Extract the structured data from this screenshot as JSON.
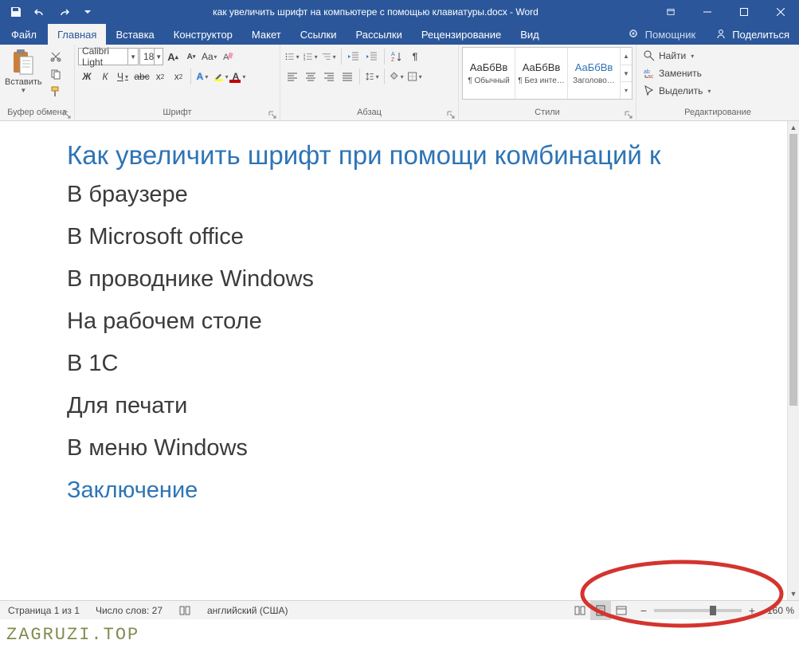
{
  "title": {
    "doc": "как увеличить шрифт на компьютере с помощью клавиатуры.docx",
    "sep": " - ",
    "app": "Word"
  },
  "tabs": {
    "file": "Файл",
    "home": "Главная",
    "insert": "Вставка",
    "design": "Конструктор",
    "layout": "Макет",
    "references": "Ссылки",
    "mail": "Рассылки",
    "review": "Рецензирование",
    "view": "Вид",
    "tellme": "Помощник",
    "share": "Поделиться"
  },
  "ribbon": {
    "clipboard": {
      "label": "Буфер обмена",
      "paste": "Вставить"
    },
    "font": {
      "label": "Шрифт",
      "name": "Calibri Light",
      "size": "18"
    },
    "paragraph": {
      "label": "Абзац"
    },
    "styles": {
      "label": "Стили",
      "items": [
        {
          "preview": "АаБбВв",
          "name": "¶ Обычный",
          "accent": false
        },
        {
          "preview": "АаБбВв",
          "name": "¶ Без инте…",
          "accent": false
        },
        {
          "preview": "АаБбВв",
          "name": "Заголово…",
          "accent": true
        }
      ]
    },
    "editing": {
      "label": "Редактирование",
      "find": "Найти",
      "replace": "Заменить",
      "select": "Выделить"
    }
  },
  "document": {
    "title": "Как увеличить шрифт при помощи комбинаций к",
    "lines": [
      "В браузере",
      "В Microsoft office",
      "В проводнике Windows",
      "На рабочем столе",
      "В 1С",
      "Для печати",
      "В меню Windows"
    ],
    "footer": "Заключение"
  },
  "status": {
    "page": "Страница 1 из 1",
    "words": "Число слов: 27",
    "lang": "английский (США)",
    "zoom": "160 %"
  },
  "watermark": "ZAGRUZI.TOP"
}
